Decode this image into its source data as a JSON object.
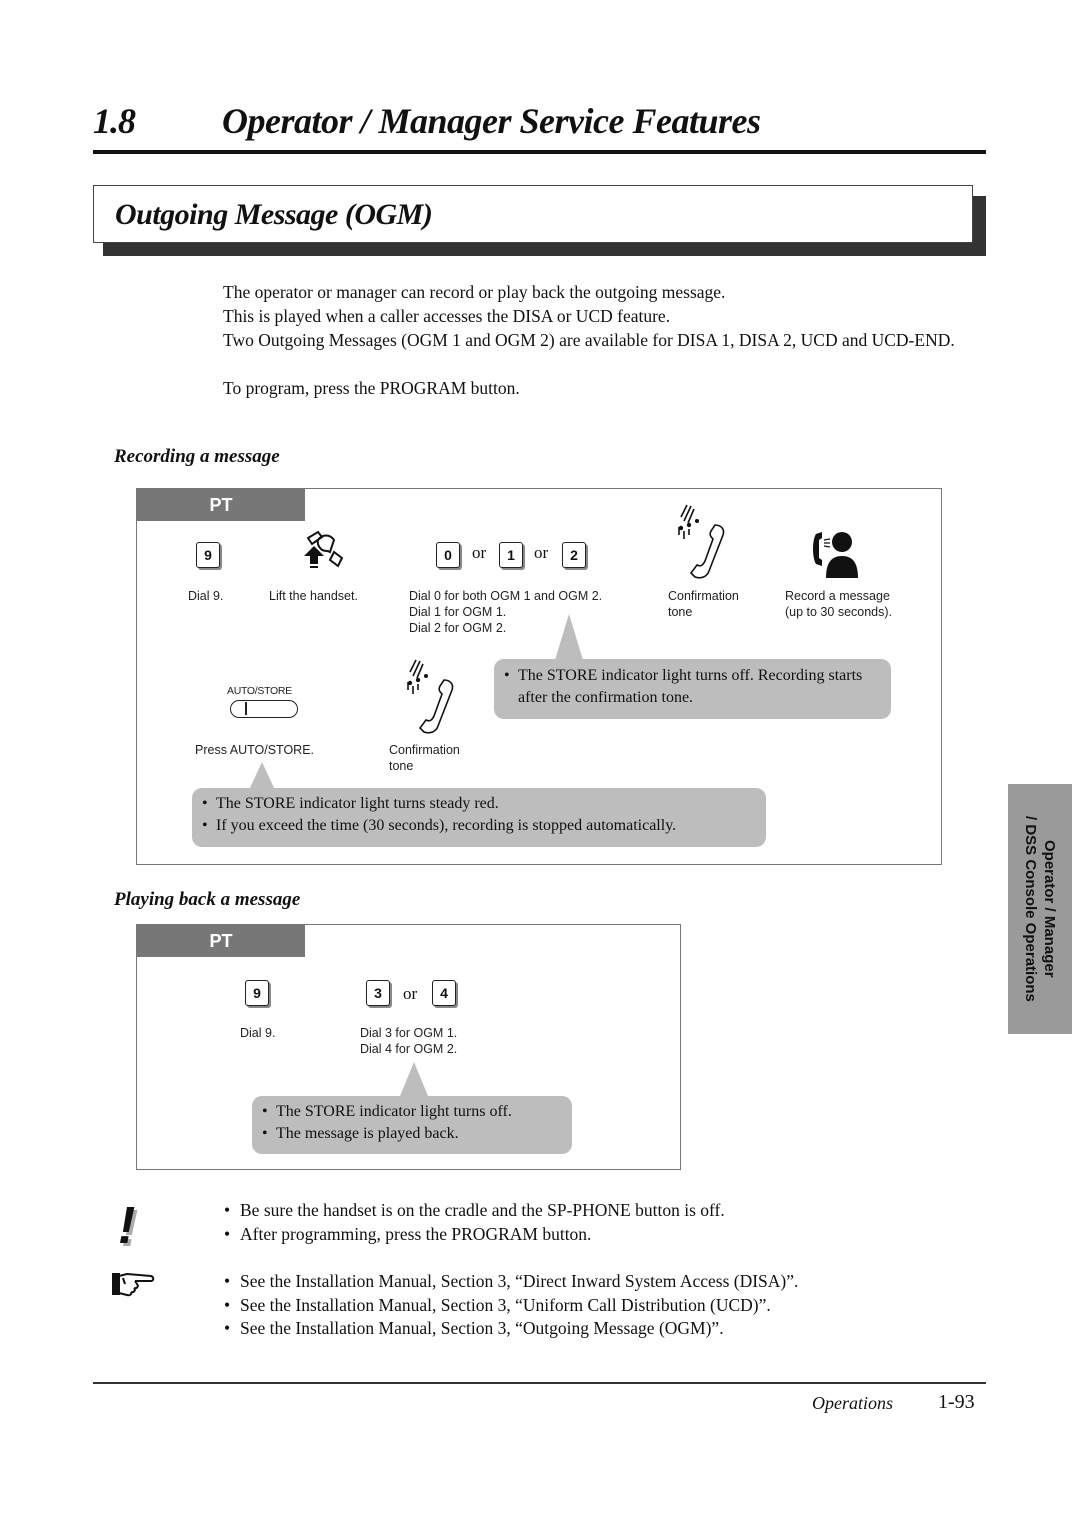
{
  "chapter": {
    "number": "1.8",
    "title": "Operator / Manager Service Features"
  },
  "section": {
    "title": "Outgoing Message (OGM)"
  },
  "intro": {
    "lines": [
      "The operator or manager can record or play back the outgoing message.",
      "This is played when a caller accesses the DISA or UCD feature.",
      "Two Outgoing Messages (OGM 1 and OGM 2) are available for DISA 1, DISA 2, UCD and UCD-END."
    ],
    "program_note": "To program, press the PROGRAM button."
  },
  "recording": {
    "heading": "Recording a message",
    "tab_label": "PT",
    "steps": [
      {
        "icon": "dial-key-icon",
        "key": "9",
        "caption": "Dial 9."
      },
      {
        "icon": "lift-handset-icon",
        "caption": "Lift the handset."
      },
      {
        "keys": [
          "0",
          "1",
          "2"
        ],
        "or_word": "or",
        "caption": "Dial 0 for both OGM 1 and OGM 2.\nDial 1 for OGM 1.\nDial 2 for OGM 2."
      },
      {
        "icon": "confirmation-tone-icon",
        "caption": "Confirmation\ntone"
      },
      {
        "icon": "record-message-icon",
        "caption": "Record a message\n(up to 30 seconds)."
      },
      {
        "icon": "auto-store-button-icon",
        "button_label": "AUTO/STORE",
        "caption": "Press AUTO/STORE."
      },
      {
        "icon": "confirmation-tone-icon",
        "caption": "Confirmation\ntone"
      }
    ],
    "bubble_store_off": [
      "The STORE indicator light turns off. Recording starts after the confirmation tone."
    ],
    "bubble_store_red": [
      "The STORE indicator light turns steady red.",
      "If you exceed the time (30 seconds), recording is stopped automatically."
    ]
  },
  "playback": {
    "heading": "Playing back a message",
    "tab_label": "PT",
    "steps": [
      {
        "key": "9",
        "caption": "Dial 9."
      },
      {
        "keys": [
          "3",
          "4"
        ],
        "or_word": "or",
        "caption": "Dial 3 for OGM 1.\nDial 4 for OGM 2."
      }
    ],
    "bubble": [
      "The STORE indicator light turns off.",
      "The message is played back."
    ]
  },
  "notes": {
    "warning_icon": "exclamation-icon",
    "warnings": [
      "Be sure the handset is on the cradle and the SP-PHONE button is off.",
      "After programming, press the PROGRAM button."
    ],
    "reference_icon": "pointing-hand-icon",
    "references": [
      "See the Installation Manual, Section 3, “Direct Inward System Access (DISA)”.",
      "See the Installation Manual, Section 3, “Uniform Call Distribution (UCD)”.",
      "See the Installation Manual, Section 3, “Outgoing Message (OGM)”."
    ]
  },
  "side_tab": {
    "line1": "Operator / Manager",
    "line2": "/ DSS Console Operations"
  },
  "footer": {
    "section": "Operations",
    "page": "1-93"
  }
}
